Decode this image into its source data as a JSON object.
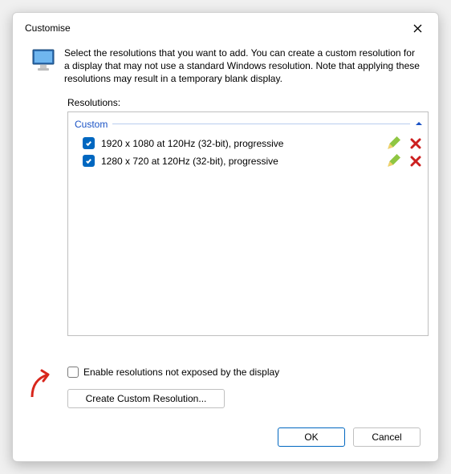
{
  "window": {
    "title": "Customise"
  },
  "description": "Select the resolutions that you want to add. You can create a custom resolution for a display that may not use a standard Windows resolution. Note that applying these resolutions may result in a temporary blank display.",
  "resolutions_label": "Resolutions:",
  "group": {
    "name": "Custom"
  },
  "items": [
    {
      "label": "1920 x 1080 at 120Hz (32-bit), progressive",
      "checked": true
    },
    {
      "label": "1280 x 720 at 120Hz (32-bit), progressive",
      "checked": true
    }
  ],
  "expose_checkbox": {
    "label": "Enable resolutions not exposed by the display",
    "checked": false
  },
  "create_button": "Create Custom Resolution...",
  "buttons": {
    "ok": "OK",
    "cancel": "Cancel"
  }
}
